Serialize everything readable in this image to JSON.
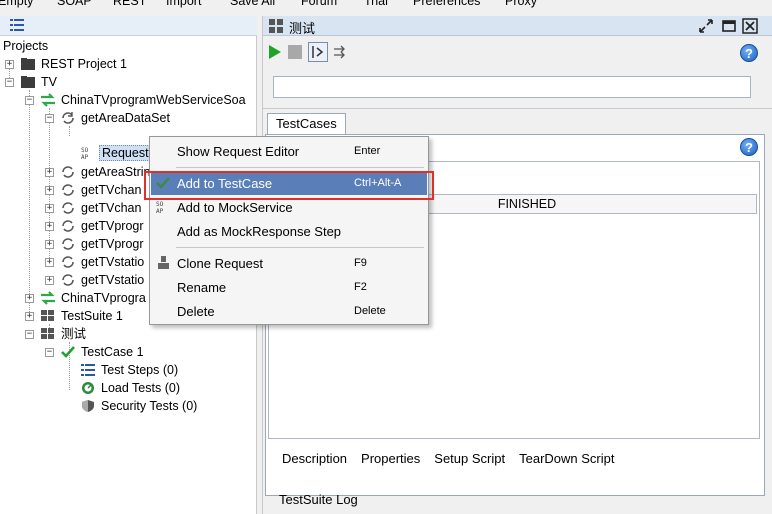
{
  "menubar": {
    "items": [
      "Empty",
      "SOAP",
      "REST",
      "Import",
      "Save All",
      "Forum",
      "Trial",
      "Preferences",
      "Proxy"
    ]
  },
  "navigator": {
    "root_label": "Projects",
    "nodes": {
      "rest_project": "REST Project 1",
      "tv": "TV",
      "service1": "ChinaTVprogramWebServiceSoa",
      "get_area_dataset": "getAreaDataSet",
      "request1": "Request 1",
      "get_area_string": "getAreaStrin",
      "get_tv_chan1": "getTVchan",
      "get_tv_chan2": "getTVchan",
      "get_tv_progr1": "getTVprogr",
      "get_tv_progr2": "getTVprogr",
      "get_tv_station1": "getTVstatio",
      "get_tv_station2": "getTVstatio",
      "service2": "ChinaTVprogra",
      "testsuite1": "TestSuite 1",
      "ceshi": "测试",
      "testcase1": "TestCase 1",
      "test_steps": "Test Steps (0)",
      "load_tests": "Load Tests (0)",
      "security_tests": "Security Tests (0)"
    }
  },
  "editor": {
    "title": "测试",
    "tab_label": "TestCases",
    "progress_text": "FINISHED",
    "bottom_tabs": [
      "Description",
      "Properties",
      "Setup Script",
      "TearDown Script"
    ],
    "log_tab": "TestSuite Log",
    "help_glyph": "?"
  },
  "context_menu": {
    "items": [
      {
        "label": "Show Request Editor",
        "shortcut": "Enter",
        "icon": ""
      },
      {
        "label": "Add to TestCase",
        "shortcut": "Ctrl+Alt-A",
        "icon": "add-testcase-icon"
      },
      {
        "label": "Add to MockService",
        "shortcut": "",
        "icon": "soap-icon"
      },
      {
        "label": "Add as MockResponse Step",
        "shortcut": "",
        "icon": ""
      },
      {
        "label": "Clone Request",
        "shortcut": "F9",
        "icon": "clone-icon"
      },
      {
        "label": "Rename",
        "shortcut": "F2",
        "icon": ""
      },
      {
        "label": "Delete",
        "shortcut": "Delete",
        "icon": ""
      }
    ]
  },
  "colors": {
    "highlight": "#5a7fb8",
    "callout_border": "#e0302c",
    "run_green": "#1fa32a",
    "service_green": "#2fa84a"
  }
}
